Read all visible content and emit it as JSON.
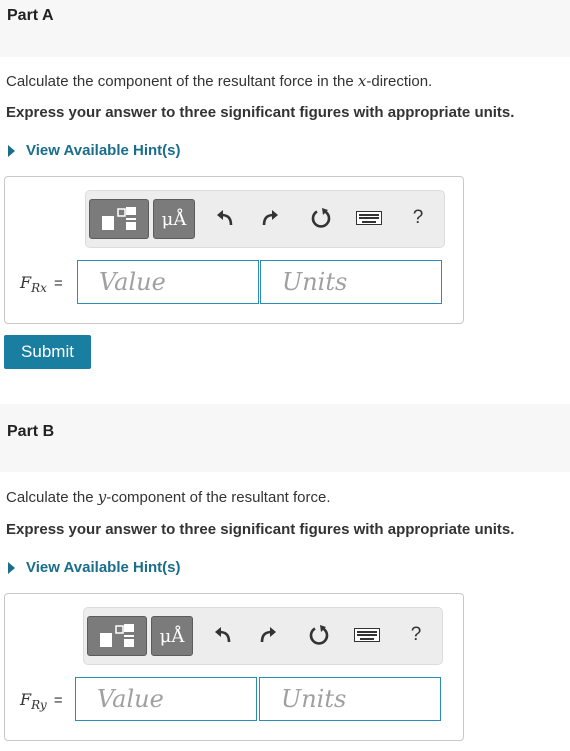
{
  "partA": {
    "title": "Part A",
    "question_pre": "Calculate the component of the resultant force in the ",
    "question_var": "x",
    "question_post": "-direction.",
    "instruction": "Express your answer to three significant figures with appropriate units.",
    "hint_link": "View Available Hint(s)",
    "label_main": "F",
    "label_sub": "Rx",
    "label_eq": "=",
    "value_placeholder": "Value",
    "units_placeholder": "Units",
    "submit_label": "Submit"
  },
  "partB": {
    "title": "Part B",
    "question_pre": "Calculate the ",
    "question_var": "y",
    "question_post": "-component of the resultant force.",
    "instruction": "Express your answer to three significant figures with appropriate units.",
    "hint_link": "View Available Hint(s)",
    "label_main": "F",
    "label_sub": "Ry",
    "label_eq": "=",
    "value_placeholder": "Value",
    "units_placeholder": "Units"
  },
  "toolbar": {
    "units_symbol": "μÅ",
    "help_label": "?"
  },
  "colors": {
    "accent": "#1a6e8c",
    "submit_bg": "#1a7ea0",
    "field_border": "#2b8cb7",
    "header_bg": "#f7f7f7"
  },
  "icons": [
    "templates-icon",
    "units-icon",
    "undo-icon",
    "redo-icon",
    "reset-icon",
    "keyboard-icon",
    "help-icon"
  ]
}
